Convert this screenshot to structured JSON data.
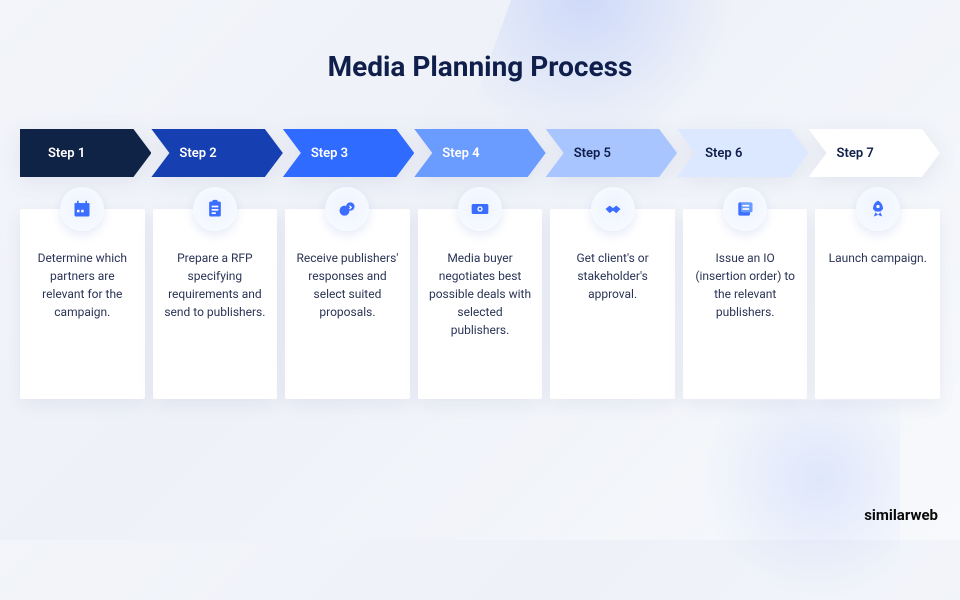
{
  "title": "Media Planning Process",
  "steps": [
    {
      "label": "Step 1",
      "color": "#0f2346",
      "textClass": "dark",
      "icon": "calendar",
      "desc": "Determine which partners are relevant for the campaign."
    },
    {
      "label": "Step 2",
      "color": "#163fb2",
      "textClass": "dark",
      "icon": "clipboard",
      "desc": "Prepare a RFP specifying requirements and send to publishers."
    },
    {
      "label": "Step 3",
      "color": "#2f6bff",
      "textClass": "dark",
      "icon": "coins",
      "desc": "Receive publishers' responses and select suited proposals."
    },
    {
      "label": "Step 4",
      "color": "#6a9bff",
      "textClass": "dark",
      "icon": "money",
      "desc": "Media buyer negotiates best possible deals with selected publishers."
    },
    {
      "label": "Step 5",
      "color": "#a9c5ff",
      "textClass": "light",
      "icon": "handshake",
      "desc": "Get client's or stakeholder's approval."
    },
    {
      "label": "Step 6",
      "color": "#dce8ff",
      "textClass": "light",
      "icon": "document",
      "desc": "Issue an IO (insertion order) to the relevant publishers."
    },
    {
      "label": "Step 7",
      "color": "#ffffff",
      "textClass": "light",
      "icon": "rocket",
      "desc": "Launch campaign."
    }
  ],
  "brand": "similarweb",
  "colors": {
    "accent": "#3b6eff",
    "heading": "#0f1e4a",
    "body": "#2a3455",
    "brandOrange": "#ff7a1a",
    "brandNavy": "#0f2346"
  }
}
